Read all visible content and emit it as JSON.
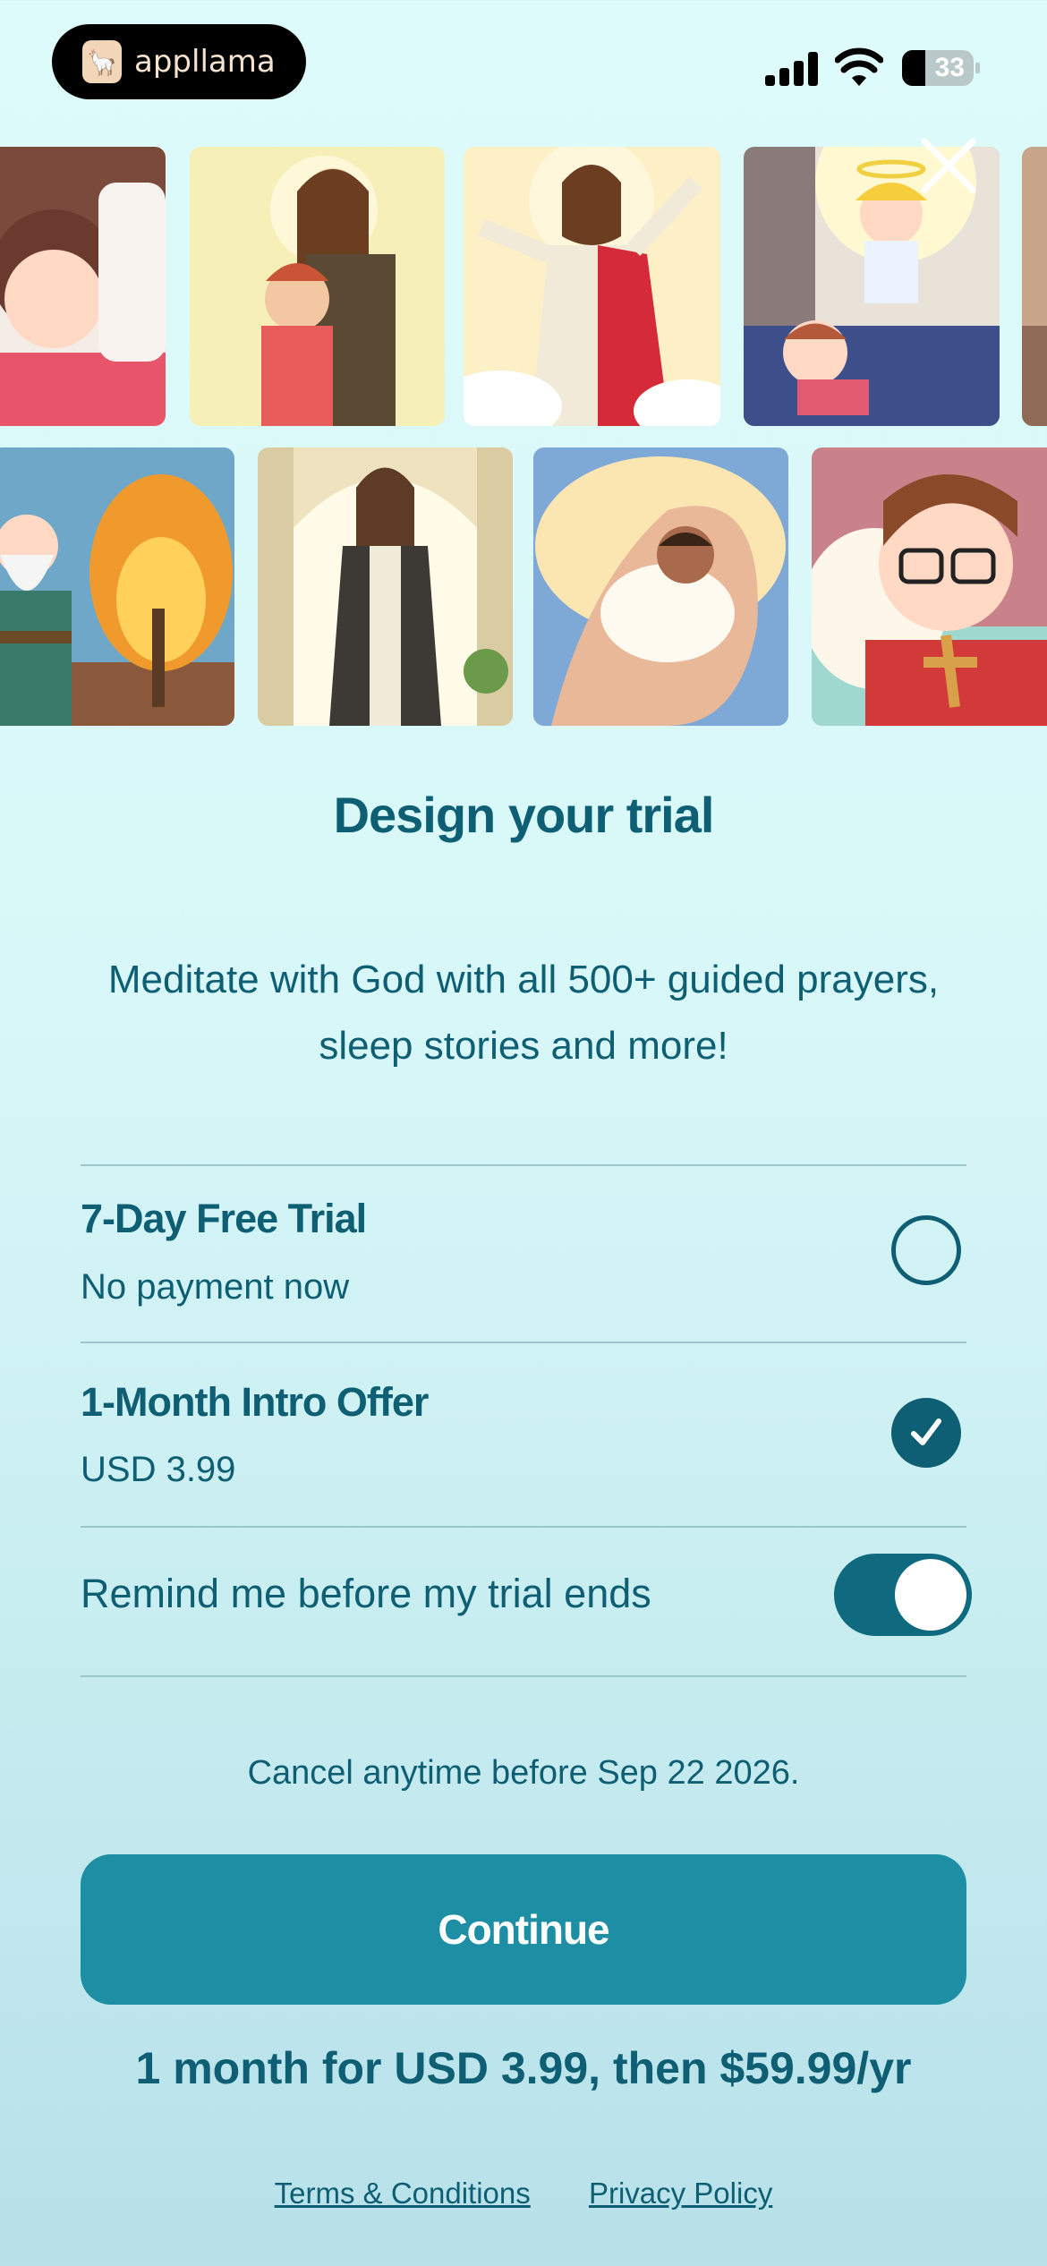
{
  "status_bar": {
    "app_badge": "appllama",
    "battery": "33"
  },
  "title": "Design your trial",
  "subtitle": "Meditate with God with all 500+ guided prayers, sleep stories and more!",
  "options": [
    {
      "title": "7-Day Free Trial",
      "subtitle": "No payment now",
      "selected": false
    },
    {
      "title": "1-Month Intro Offer",
      "subtitle": "USD 3.99",
      "selected": true
    }
  ],
  "reminder": {
    "label": "Remind me before my trial ends",
    "enabled": true
  },
  "cancel_note": "Cancel anytime before Sep 22 2026.",
  "continue_label": "Continue",
  "price_summary": "1 month for USD 3.99, then $59.99/yr",
  "links": {
    "terms": "Terms & Conditions",
    "privacy": "Privacy Policy"
  },
  "icons": [
    "llama-logo-icon",
    "signal-icon",
    "wifi-icon",
    "battery-icon",
    "close-icon",
    "check-icon"
  ],
  "colors": {
    "primary": "#0f5f74",
    "button": "#1e8ea5",
    "toggle": "#0f6a80",
    "background": "#defbfb"
  }
}
